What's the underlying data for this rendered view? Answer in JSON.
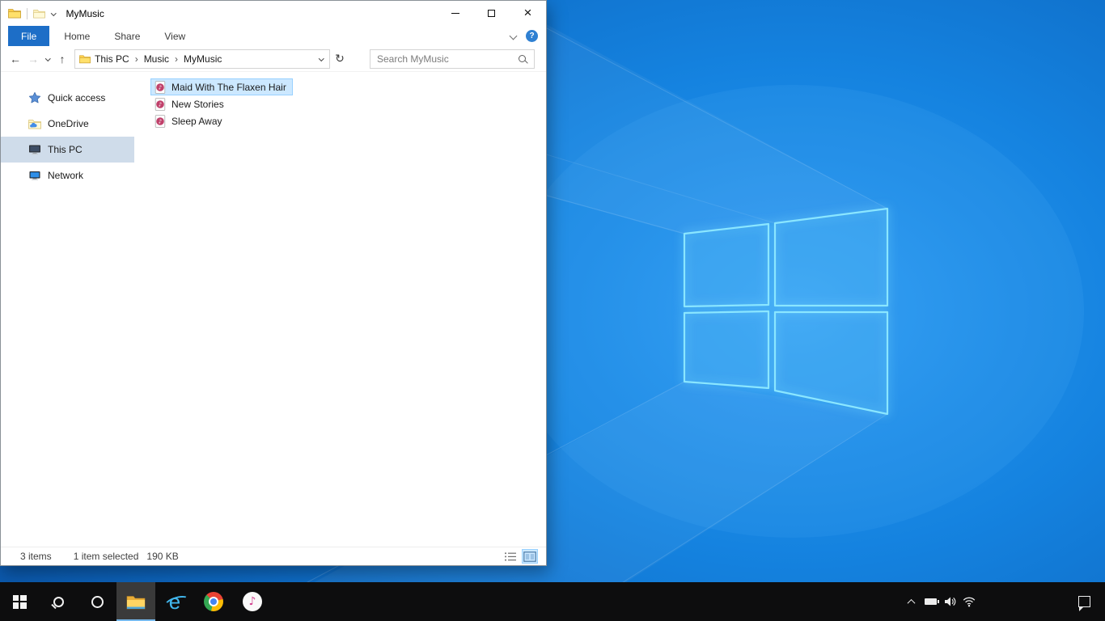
{
  "icons": {
    "back": "←",
    "forward": "→",
    "up": "↑",
    "refresh": "↻",
    "help": "?",
    "close": "×",
    "breadcrumb_separator": "›",
    "note": "♪",
    "ie_logo": "e"
  },
  "colors": {
    "accent": "#0078d7",
    "file_tab": "#1d6ec7",
    "selection_fill": "#cce8ff",
    "selection_border": "#99d1ff",
    "nav_selected": "#cfdcea",
    "taskbar": "#0d0d0e",
    "desktop_center": "#2e9bf2",
    "desktop_edge": "#0a55a8",
    "logo_glow": "#8ae6ff"
  },
  "window": {
    "title": "MyMusic",
    "menu": {
      "file": "File",
      "home": "Home",
      "share": "Share",
      "view": "View"
    },
    "address": {
      "crumbs": [
        "This PC",
        "Music",
        "MyMusic"
      ]
    },
    "search_placeholder": "Search MyMusic",
    "nav": [
      {
        "label": "Quick access",
        "icon": "star-icon"
      },
      {
        "label": "OneDrive",
        "icon": "onedrive-folder-icon"
      },
      {
        "label": "This PC",
        "icon": "this-pc-icon",
        "selected": true
      },
      {
        "label": "Network",
        "icon": "network-icon"
      }
    ],
    "files": [
      {
        "label": "Maid With The Flaxen Hair",
        "icon": "media-file-icon",
        "selected": true
      },
      {
        "label": "New Stories",
        "icon": "media-file-icon",
        "selected": false
      },
      {
        "label": "Sleep Away",
        "icon": "media-file-icon",
        "selected": false
      }
    ],
    "status": {
      "items": "3 items",
      "selection": "1 item selected",
      "size": "190 KB"
    }
  },
  "taskbar": {
    "buttons": [
      "start",
      "search",
      "cortana",
      "file-explorer",
      "internet-explorer",
      "chrome",
      "itunes"
    ],
    "active_button": "file-explorer",
    "tray": [
      "hidden-icons",
      "battery",
      "volume",
      "network",
      "action-center",
      "show-desktop"
    ]
  }
}
